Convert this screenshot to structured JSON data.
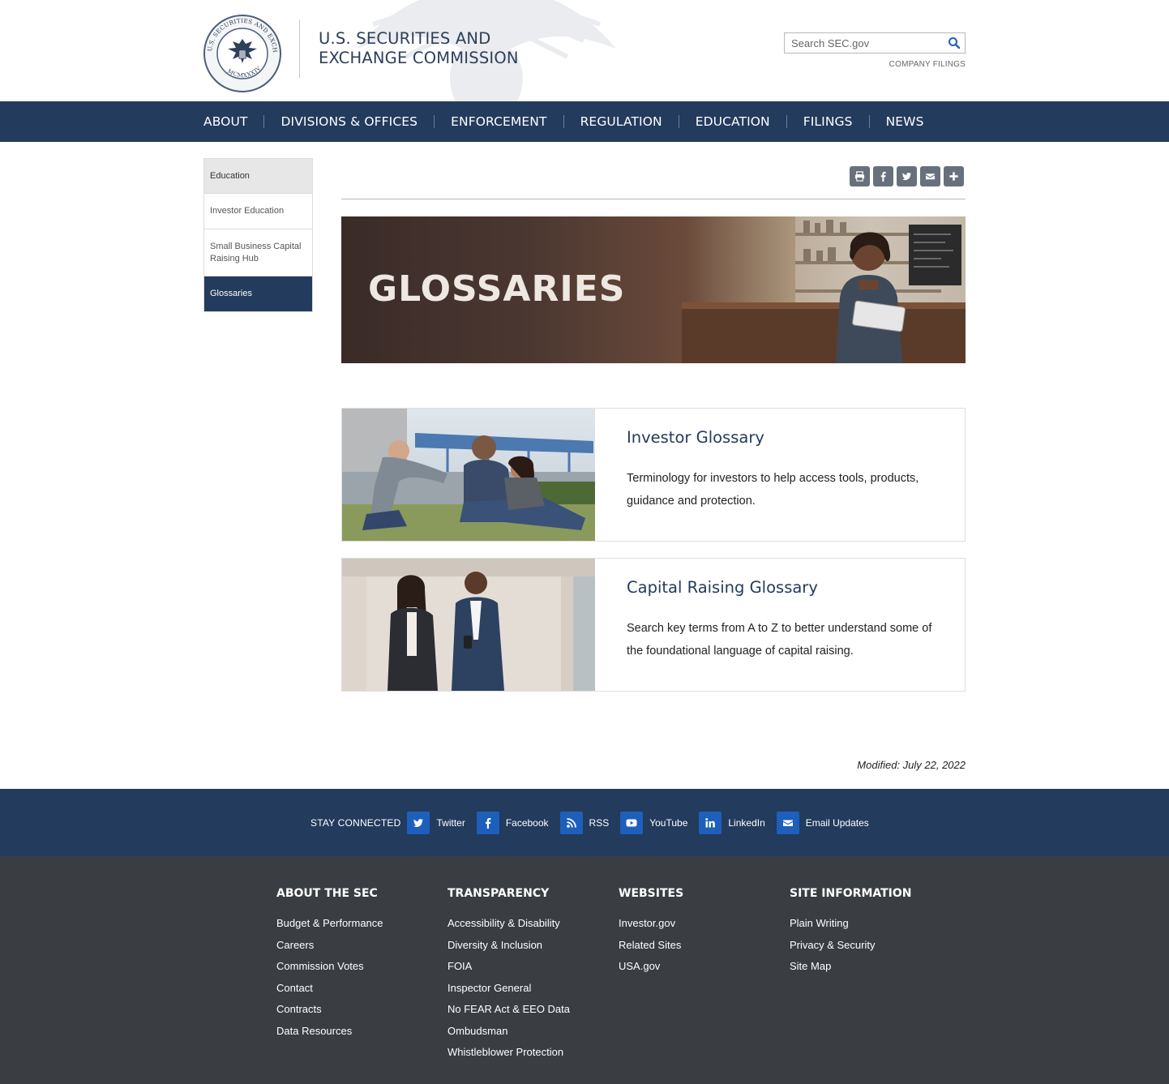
{
  "header": {
    "agency_line1": "U.S. SECURITIES AND",
    "agency_line2": "EXCHANGE COMMISSION",
    "search_placeholder": "Search SEC.gov",
    "company_filings": "COMPANY FILINGS",
    "seal_text": "U.S. SECURITIES AND EXCHANGE COMMISSION MCMXXXIV"
  },
  "nav": {
    "items": [
      "ABOUT",
      "DIVISIONS & OFFICES",
      "ENFORCEMENT",
      "REGULATION",
      "EDUCATION",
      "FILINGS",
      "NEWS"
    ]
  },
  "sidebar": {
    "items": [
      "Education",
      "Investor Education",
      "Small Business Capital Raising Hub",
      "Glossaries"
    ]
  },
  "share_tools": [
    "print-icon",
    "facebook-icon",
    "twitter-icon",
    "email-icon",
    "plus-icon"
  ],
  "banner": {
    "title": "GLOSSARIES"
  },
  "cards": [
    {
      "title": "Investor Glossary",
      "description": "Terminology for investors to help access tools, products, guidance and protection."
    },
    {
      "title": "Capital Raising Glossary",
      "description": "Search key terms from A to Z to better understand some of the foundational language of capital raising."
    }
  ],
  "modified": "Modified: July 22, 2022",
  "stay_connected": {
    "label": "STAY CONNECTED",
    "links": [
      "Twitter",
      "Facebook",
      "RSS",
      "YouTube",
      "LinkedIn",
      "Email Updates"
    ]
  },
  "footer": {
    "columns": [
      {
        "heading": "ABOUT THE SEC",
        "links": [
          "Budget & Performance",
          "Careers",
          "Commission Votes",
          "Contact",
          "Contracts",
          "Data Resources"
        ]
      },
      {
        "heading": "TRANSPARENCY",
        "links": [
          "Accessibility & Disability",
          "Diversity & Inclusion",
          "FOIA",
          "Inspector General",
          "No FEAR Act & EEO Data",
          "Ombudsman",
          "Whistleblower Protection"
        ]
      },
      {
        "heading": "WEBSITES",
        "links": [
          "Investor.gov",
          "Related Sites",
          "USA.gov"
        ]
      },
      {
        "heading": "SITE INFORMATION",
        "links": [
          "Plain Writing",
          "Privacy & Security",
          "Site Map"
        ]
      }
    ]
  },
  "colors": {
    "navy": "#233b5d",
    "social_blue": "#1d5fbb",
    "footer_bg": "#3a3d42",
    "share_gray": "#67707c"
  }
}
